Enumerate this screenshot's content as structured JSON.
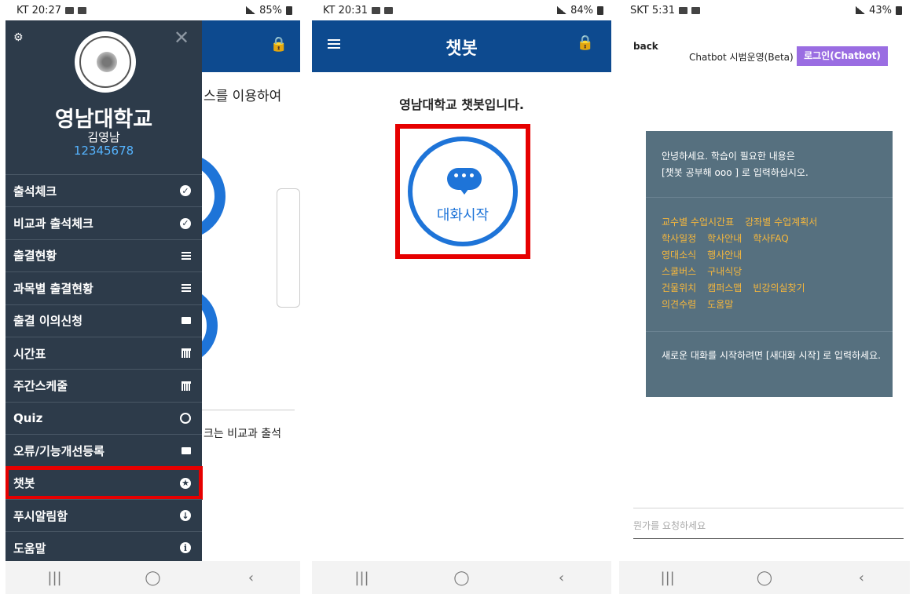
{
  "panels": {
    "p1": {
      "status": {
        "left": "KT 20:27",
        "right": "85%"
      },
      "bg_text_1": "스를 이용하여",
      "bg_text_2": "크는 비교과 출석",
      "drawer": {
        "university": "영남대학교",
        "user_name": "김영남",
        "user_id": "12345678",
        "items": [
          {
            "label": "출석체크",
            "icon": "check-circle-icon"
          },
          {
            "label": "비교과 출석체크",
            "icon": "check-circle-icon"
          },
          {
            "label": "출결현황",
            "icon": "list-icon"
          },
          {
            "label": "과목별 출결현황",
            "icon": "list-icon"
          },
          {
            "label": "출결 이의신청",
            "icon": "mail-icon"
          },
          {
            "label": "시간표",
            "icon": "calendar-icon"
          },
          {
            "label": "주간스케줄",
            "icon": "calendar-icon"
          },
          {
            "label": "Quiz",
            "icon": "clock-icon"
          },
          {
            "label": "오류/기능개선등록",
            "icon": "mail-icon"
          },
          {
            "label": "챗봇",
            "icon": "star-icon",
            "highlighted": true
          },
          {
            "label": "푸시알림함",
            "icon": "download-icon"
          },
          {
            "label": "도움말",
            "icon": "info-icon"
          }
        ]
      }
    },
    "p2": {
      "status": {
        "left": "KT 20:31",
        "right": "84%"
      },
      "title": "챗봇",
      "welcome": "영남대학교 챗봇입니다.",
      "start_label": "대화시작",
      "bubble_text": "•••"
    },
    "p3": {
      "status": {
        "left": "SKT 5:31",
        "right": "43%"
      },
      "back": "back",
      "bot_title": "Chatbot 시범운영(Beta)",
      "login": "로그인(Chatbot)",
      "greeting_1": "안녕하세요. 학습이 필요한 내용은",
      "greeting_2": "[챗봇 공부해 ooo ] 로 입력하십시오.",
      "links": [
        [
          "교수별 수업시간표",
          "강좌별 수업계획서"
        ],
        [
          "학사일정",
          "학사안내",
          "학사FAQ"
        ],
        [
          "영대소식",
          "행사안내"
        ],
        [
          "스쿨버스",
          "구내식당"
        ],
        [
          "건물위치",
          "캠퍼스맵",
          "빈강의실찾기"
        ],
        [
          "의견수렴",
          "도움말"
        ]
      ],
      "restart": "새로운 대화를 시작하려면 [새대화 시작] 로 입력하세요.",
      "input_placeholder": "뭔가를 요청하세요"
    }
  },
  "nav": {
    "recent": "|||",
    "home": "◯",
    "back": "‹"
  },
  "colors": {
    "primary": "#0d4a8f",
    "drawer": "#2d3b4a",
    "accent": "#1e74d8",
    "highlight": "#e60000",
    "login": "#9a6de2",
    "link": "#f6b73c",
    "card": "#56707f"
  }
}
